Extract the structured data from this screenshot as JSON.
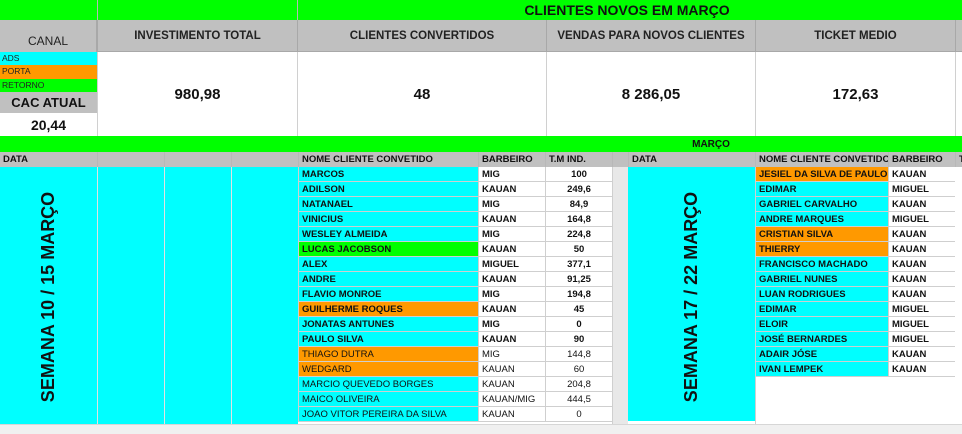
{
  "title": "CLIENTES NOVOS EM MARÇO",
  "canal_label": "CANAL",
  "legend": [
    {
      "label": "ADS",
      "color": "#00ffff"
    },
    {
      "label": "PORTA",
      "color": "#ff9900"
    },
    {
      "label": "RETORNO",
      "color": "#00ff00"
    }
  ],
  "cac": {
    "label": "CAC ATUAL",
    "value": "20,44"
  },
  "kpis": [
    {
      "header": "INVESTIMENTO TOTAL",
      "value": "980,98"
    },
    {
      "header": "CLIENTES CONVERTIDOS",
      "value": "48"
    },
    {
      "header": "VENDAS PARA NOVOS CLIENTES",
      "value": "8 286,05"
    },
    {
      "header": "TICKET MEDIO",
      "value": "172,63"
    }
  ],
  "month_label": "MARÇO",
  "left": {
    "data_header": "DATA",
    "name_header": "NOME CLIENTE CONVETIDO",
    "barber_header": "BARBEIRO",
    "tm_header": "T.M IND.",
    "week_label": "SEMANA 10 / 15 MARÇO",
    "rows": [
      {
        "name": "MARCOS",
        "barber": "MIG",
        "tm": "100",
        "channel": "ads",
        "bold": true
      },
      {
        "name": "ADILSON",
        "barber": "KAUAN",
        "tm": "249,6",
        "channel": "ads",
        "bold": true
      },
      {
        "name": "NATANAEL",
        "barber": "MIG",
        "tm": "84,9",
        "channel": "ads",
        "bold": true
      },
      {
        "name": "VINICIUS",
        "barber": "KAUAN",
        "tm": "164,8",
        "channel": "ads",
        "bold": true
      },
      {
        "name": "WESLEY ALMEIDA",
        "barber": "MIG",
        "tm": "224,8",
        "channel": "ads",
        "bold": true
      },
      {
        "name": "LUCAS JACOBSON",
        "barber": "KAUAN",
        "tm": "50",
        "channel": "retorno",
        "bold": true
      },
      {
        "name": "ALEX",
        "barber": "MIGUEL",
        "tm": "377,1",
        "channel": "ads",
        "bold": true
      },
      {
        "name": "ANDRE",
        "barber": "KAUAN",
        "tm": "91,25",
        "channel": "ads",
        "bold": true
      },
      {
        "name": "FLAVIO MONROE",
        "barber": "MIG",
        "tm": "194,8",
        "channel": "ads",
        "bold": true
      },
      {
        "name": "GUILHERME ROQUES",
        "barber": "KAUAN",
        "tm": "45",
        "channel": "porta",
        "bold": true
      },
      {
        "name": "JONATAS ANTUNES",
        "barber": "MIG",
        "tm": "0",
        "channel": "ads",
        "bold": true
      },
      {
        "name": "PAULO SILVA",
        "barber": "KAUAN",
        "tm": "90",
        "channel": "ads",
        "bold": true
      },
      {
        "name": "THIAGO DUTRA",
        "barber": "MIG",
        "tm": "144,8",
        "channel": "porta",
        "bold": false
      },
      {
        "name": "WEDGARD",
        "barber": "KAUAN",
        "tm": "60",
        "channel": "porta",
        "bold": false
      },
      {
        "name": "MARCIO QUEVEDO BORGES",
        "barber": "KAUAN",
        "tm": "204,8",
        "channel": "ads",
        "bold": false
      },
      {
        "name": "MAICO OLIVEIRA",
        "barber": "KAUAN/MIG",
        "tm": "444,5",
        "channel": "ads",
        "bold": false
      },
      {
        "name": "JOAO VITOR PEREIRA DA SILVA",
        "barber": "KAUAN",
        "tm": "0",
        "channel": "ads",
        "bold": false
      }
    ]
  },
  "right": {
    "data_header": "DATA",
    "name_header": "NOME CLIENTE CONVETIDO",
    "barber_header": "BARBEIRO",
    "week_label": "SEMANA 17 / 22 MARÇO",
    "rows": [
      {
        "name": "JESIEL DA SILVA DE PAULO",
        "barber": "KAUAN",
        "channel": "porta"
      },
      {
        "name": "EDIMAR",
        "barber": "MIGUEL",
        "channel": "ads"
      },
      {
        "name": "GABRIEL CARVALHO",
        "barber": "KAUAN",
        "channel": "ads"
      },
      {
        "name": "ANDRE MARQUES",
        "barber": "MIGUEL",
        "channel": "ads"
      },
      {
        "name": "CRISTIAN SILVA",
        "barber": "KAUAN",
        "channel": "porta"
      },
      {
        "name": "THIERRY",
        "barber": "KAUAN",
        "channel": "porta"
      },
      {
        "name": "FRANCISCO MACHADO",
        "barber": "KAUAN",
        "channel": "ads"
      },
      {
        "name": "GABRIEL NUNES",
        "barber": "KAUAN",
        "channel": "ads"
      },
      {
        "name": "LUAN RODRIGUES",
        "barber": "KAUAN",
        "channel": "ads"
      },
      {
        "name": "EDIMAR",
        "barber": "MIGUEL",
        "channel": "ads"
      },
      {
        "name": "ELOIR",
        "barber": "MIGUEL",
        "channel": "ads"
      },
      {
        "name": "JOSÉ BERNARDES",
        "barber": "MIGUEL",
        "channel": "ads"
      },
      {
        "name": "ADAIR JÓSE",
        "barber": "KAUAN",
        "channel": "ads"
      },
      {
        "name": "IVAN LEMPEK",
        "barber": "KAUAN",
        "channel": "ads"
      }
    ]
  }
}
